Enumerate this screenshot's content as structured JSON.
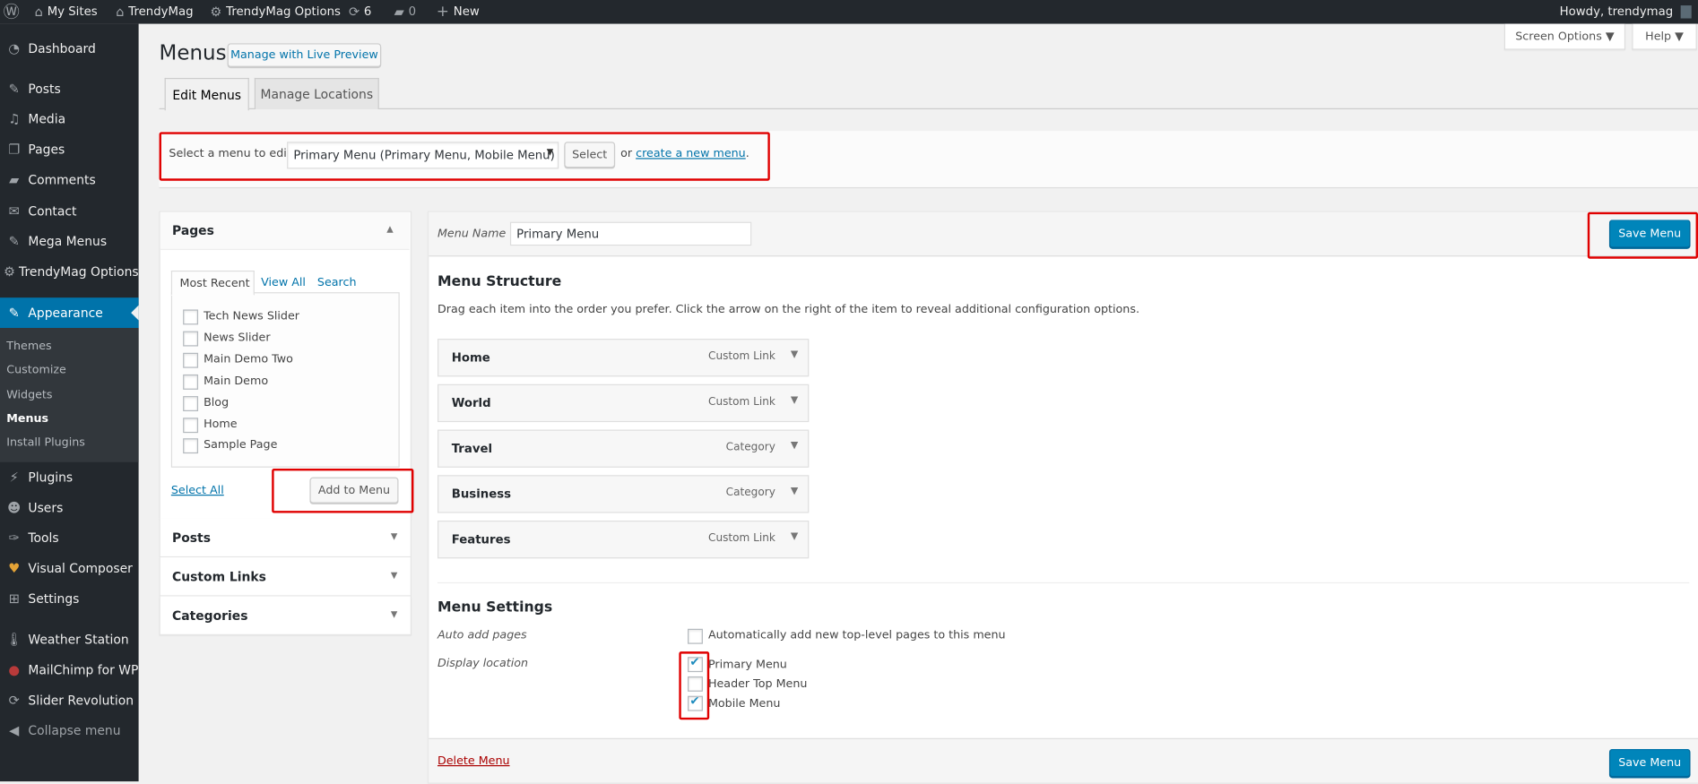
{
  "admin_bar": {
    "wp_logo": "wordpress-icon",
    "my_sites": "My Sites",
    "site_name": "TrendyMag",
    "options": "TrendyMag Options",
    "updates_count": "6",
    "comments_count": "0",
    "new_label": "New",
    "howdy": "Howdy, trendymag"
  },
  "sidebar": {
    "items": [
      {
        "label": "Dashboard",
        "icon": "dashboard-icon"
      },
      {
        "label": "Posts",
        "icon": "pin-icon"
      },
      {
        "label": "Media",
        "icon": "media-icon"
      },
      {
        "label": "Pages",
        "icon": "pages-icon"
      },
      {
        "label": "Comments",
        "icon": "comment-icon"
      },
      {
        "label": "Contact",
        "icon": "envelope-icon"
      },
      {
        "label": "Mega Menus",
        "icon": "pin-icon"
      },
      {
        "label": "TrendyMag Options",
        "icon": "gear-icon"
      },
      {
        "label": "Appearance",
        "icon": "brush-icon"
      },
      {
        "label": "Plugins",
        "icon": "plug-icon"
      },
      {
        "label": "Users",
        "icon": "user-icon"
      },
      {
        "label": "Tools",
        "icon": "wrench-icon"
      },
      {
        "label": "Visual Composer",
        "icon": "vc-icon"
      },
      {
        "label": "Settings",
        "icon": "settings-icon"
      },
      {
        "label": "Weather Station",
        "icon": "thermometer-icon"
      },
      {
        "label": "MailChimp for WP",
        "icon": "mailchimp-icon"
      },
      {
        "label": "Slider Revolution",
        "icon": "refresh-icon"
      },
      {
        "label": "Collapse menu",
        "icon": "collapse-icon"
      }
    ],
    "submenu": [
      "Themes",
      "Customize",
      "Widgets",
      "Menus",
      "Install Plugins"
    ]
  },
  "header": {
    "title": "Menus",
    "live_preview": "Manage with Live Preview",
    "screen_options": "Screen Options ▼",
    "help": "Help ▼",
    "tabs": [
      "Edit Menus",
      "Manage Locations"
    ]
  },
  "select_menu": {
    "label": "Select a menu to edit:",
    "selected": "Primary Menu (Primary Menu, Mobile Menu)",
    "select_button": "Select",
    "or": "or",
    "create_link": "create a new menu",
    "period": "."
  },
  "pages_box": {
    "title": "Pages",
    "tabs": [
      "Most Recent",
      "View All",
      "Search"
    ],
    "items": [
      "Tech News Slider",
      "News Slider",
      "Main Demo Two",
      "Main Demo",
      "Blog",
      "Home",
      "Sample Page"
    ],
    "select_all": "Select All",
    "add_button": "Add to Menu"
  },
  "accordions": [
    "Posts",
    "Custom Links",
    "Categories"
  ],
  "menu_edit": {
    "name_label": "Menu Name",
    "name_value": "Primary Menu",
    "save_button": "Save Menu",
    "structure_title": "Menu Structure",
    "structure_help": "Drag each item into the order you prefer. Click the arrow on the right of the item to reveal additional configuration options.",
    "items": [
      {
        "label": "Home",
        "type": "Custom Link"
      },
      {
        "label": "World",
        "type": "Custom Link"
      },
      {
        "label": "Travel",
        "type": "Category"
      },
      {
        "label": "Business",
        "type": "Category"
      },
      {
        "label": "Features",
        "type": "Custom Link"
      }
    ],
    "settings_title": "Menu Settings",
    "auto_add_label": "Auto add pages",
    "auto_add_text": "Automatically add new top-level pages to this menu",
    "display_label": "Display location",
    "locations": [
      {
        "label": "Primary Menu",
        "checked": true
      },
      {
        "label": "Header Top Menu",
        "checked": false
      },
      {
        "label": "Mobile Menu",
        "checked": true
      }
    ],
    "delete_link": "Delete Menu"
  },
  "colors": {
    "accent": "#0073aa",
    "highlight": "#e00000",
    "adminbar": "#23282d"
  }
}
